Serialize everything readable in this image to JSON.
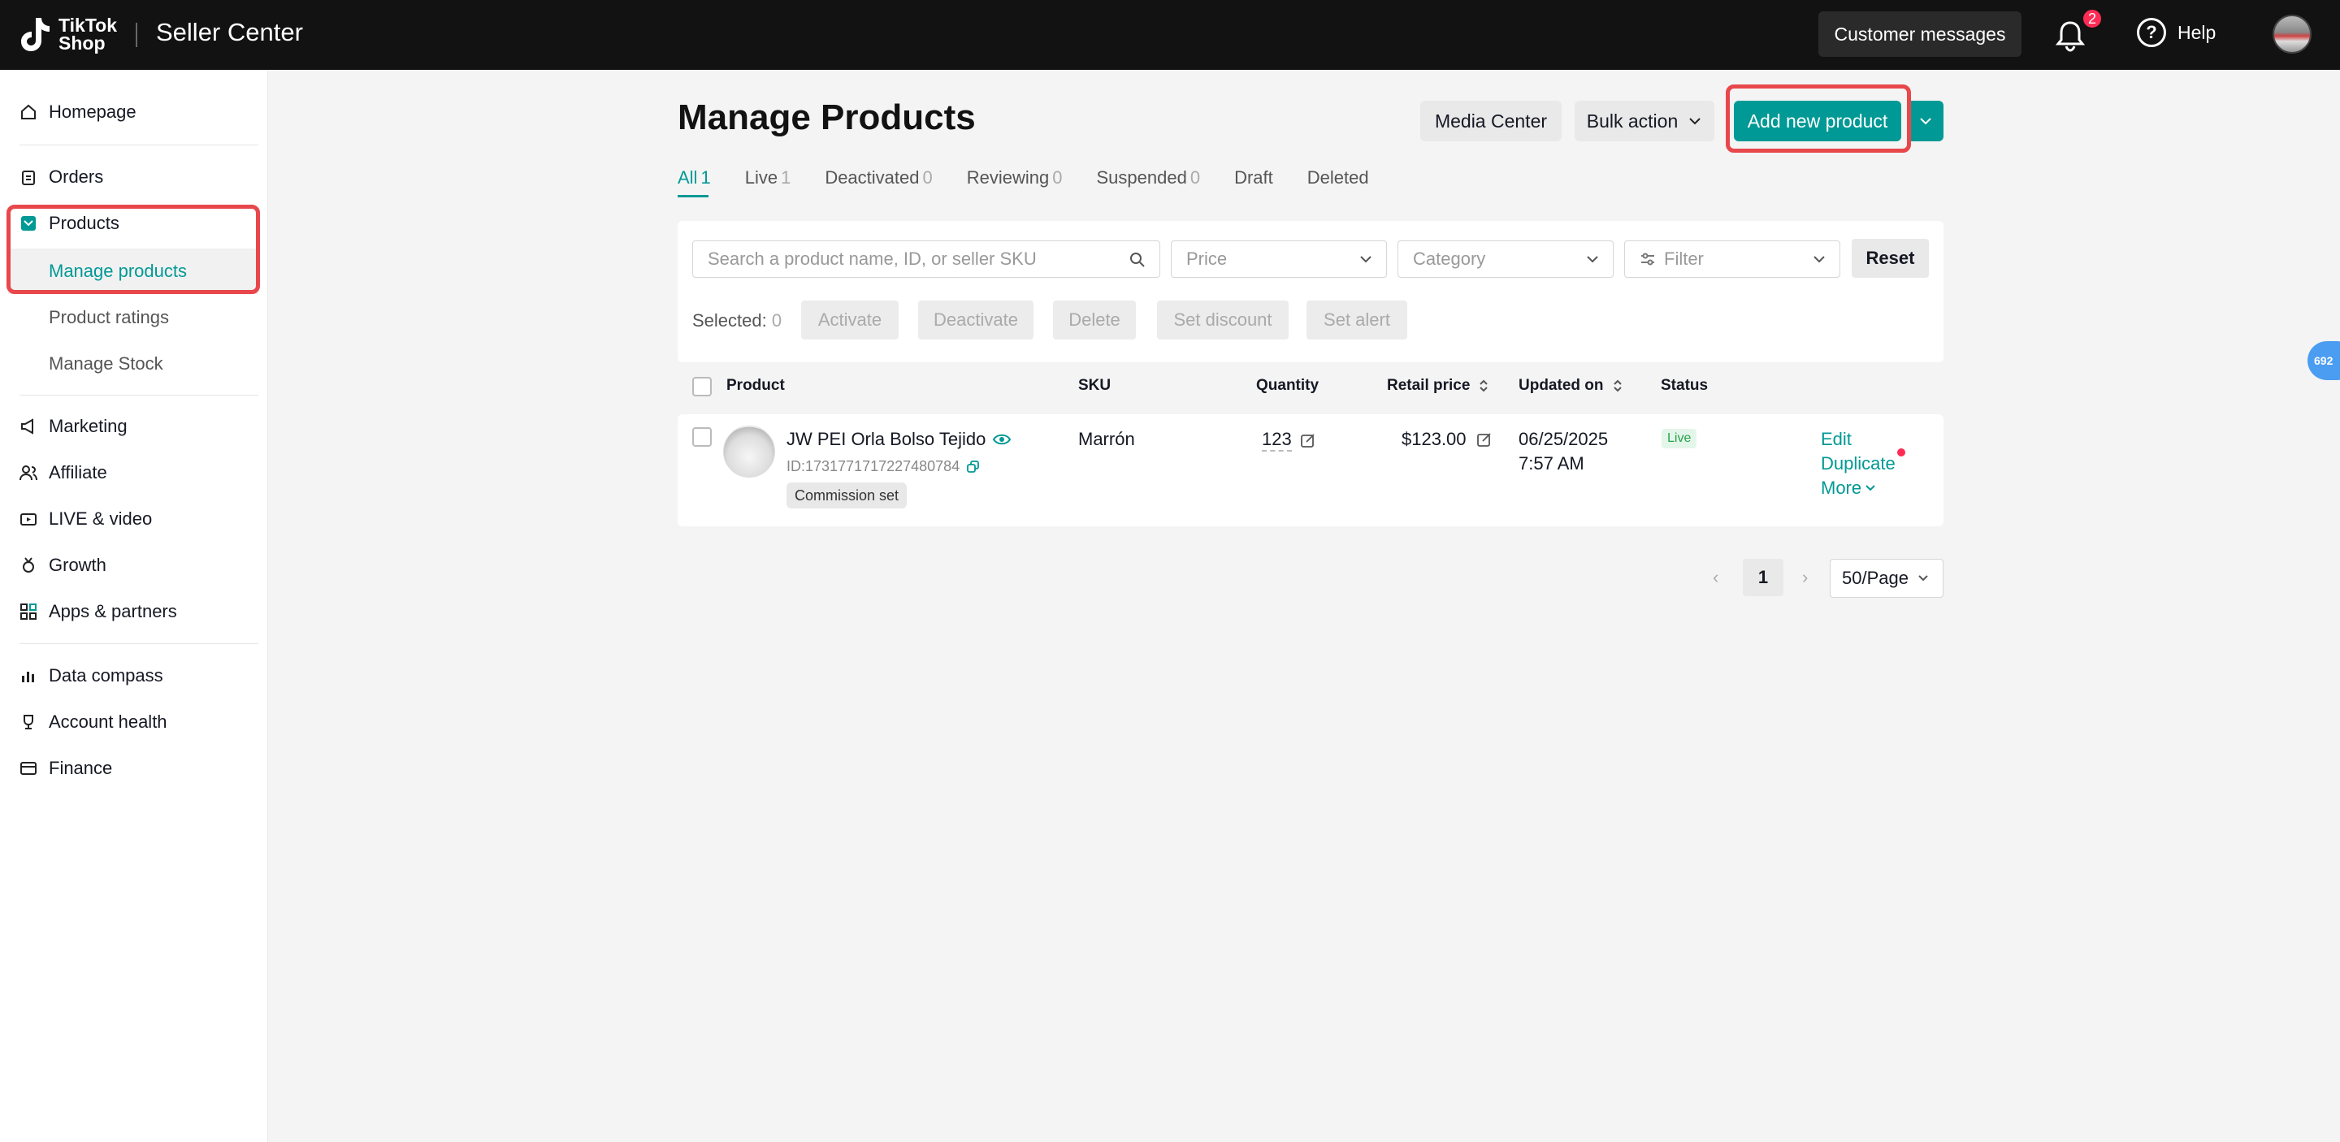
{
  "header": {
    "logo_line1": "TikTok",
    "logo_line2": "Shop",
    "title": "Seller Center",
    "customer_messages": "Customer messages",
    "notification_count": "2",
    "help": "Help"
  },
  "sidebar": {
    "homepage": "Homepage",
    "orders": "Orders",
    "products": "Products",
    "manage_products": "Manage products",
    "product_ratings": "Product ratings",
    "manage_stock": "Manage Stock",
    "marketing": "Marketing",
    "affiliate": "Affiliate",
    "live_video": "LIVE & video",
    "growth": "Growth",
    "apps_partners": "Apps & partners",
    "data_compass": "Data compass",
    "account_health": "Account health",
    "finance": "Finance"
  },
  "main": {
    "title": "Manage Products",
    "media_center": "Media Center",
    "bulk_action": "Bulk action",
    "add_new_product": "Add new product",
    "tabs": [
      {
        "label": "All",
        "count": "1"
      },
      {
        "label": "Live",
        "count": "1"
      },
      {
        "label": "Deactivated",
        "count": "0"
      },
      {
        "label": "Reviewing",
        "count": "0"
      },
      {
        "label": "Suspended",
        "count": "0"
      },
      {
        "label": "Draft",
        "count": ""
      },
      {
        "label": "Deleted",
        "count": ""
      }
    ],
    "filters": {
      "search_placeholder": "Search a product name, ID, or seller SKU",
      "price": "Price",
      "category": "Category",
      "filter": "Filter",
      "reset": "Reset"
    },
    "selection": {
      "label": "Selected:",
      "count": "0",
      "activate": "Activate",
      "deactivate": "Deactivate",
      "delete": "Delete",
      "set_discount": "Set discount",
      "set_alert": "Set alert"
    },
    "table": {
      "headers": {
        "product": "Product",
        "sku": "SKU",
        "quantity": "Quantity",
        "retail_price": "Retail price",
        "updated_on": "Updated on",
        "status": "Status"
      },
      "rows": [
        {
          "name": "JW PEI Orla Bolso Tejido",
          "id": "ID:1731771717227480784",
          "tag": "Commission set",
          "sku": "Marrón",
          "quantity": "123",
          "price": "$123.00",
          "updated_date": "06/25/2025",
          "updated_time": "7:57 AM",
          "status": "Live",
          "actions": {
            "edit": "Edit",
            "duplicate": "Duplicate",
            "more": "More"
          }
        }
      ]
    },
    "pagination": {
      "current_page": "1",
      "per_page": "50/Page"
    }
  },
  "floating_badge": "692"
}
